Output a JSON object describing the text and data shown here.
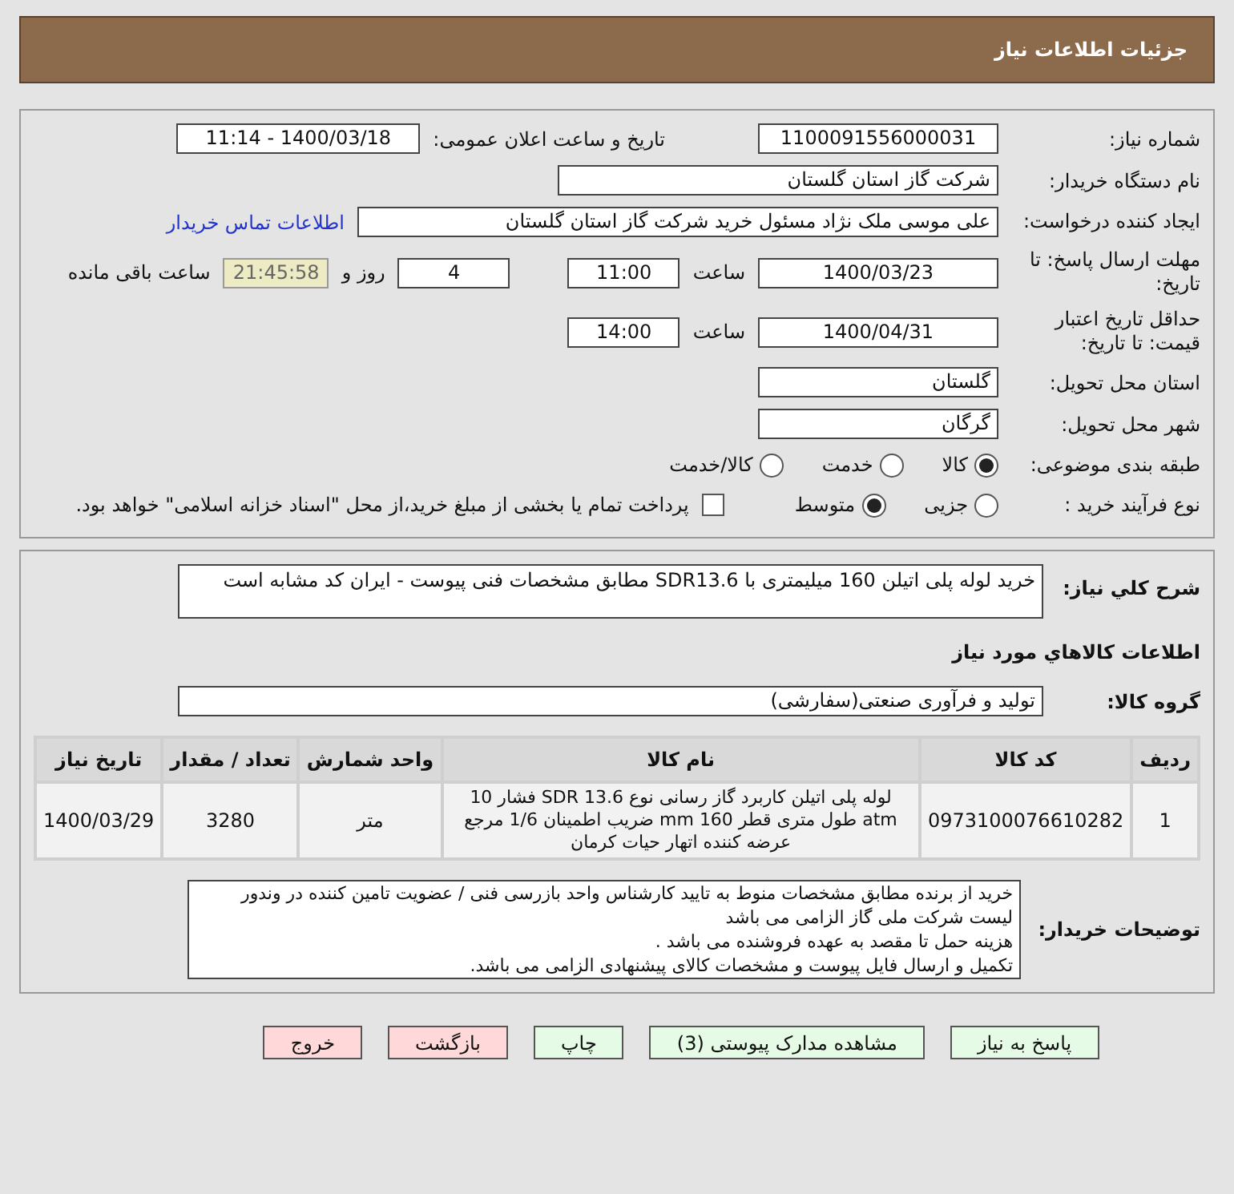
{
  "header": {
    "title": "جزئیات اطلاعات نیاز"
  },
  "details": {
    "need_number": {
      "label": "شماره نیاز:",
      "value": "1100091556000031"
    },
    "announce": {
      "label": "تاریخ و ساعت اعلان عمومی:",
      "value": "1400/03/18 - 11:14"
    },
    "buyer_org": {
      "label": "نام دستگاه خریدار:",
      "value": "شرکت گاز استان گلستان"
    },
    "requester": {
      "label": "ایجاد کننده درخواست:",
      "value": "علی موسی ملک نژاد مسئول خرید شرکت گاز استان گلستان",
      "link": "اطلاعات تماس خریدار"
    },
    "deadline": {
      "label": "مهلت ارسال پاسخ: تا تاریخ:",
      "date": "1400/03/23",
      "time_label": "ساعت",
      "time": "11:00",
      "days": "4",
      "days_label": "روز و",
      "remaining": "21:45:58",
      "remaining_label": "ساعت باقی مانده"
    },
    "validity": {
      "label": "حداقل تاریخ اعتبار قیمت: تا تاریخ:",
      "date": "1400/04/31",
      "time_label": "ساعت",
      "time": "14:00"
    },
    "province": {
      "label": "استان محل تحویل:",
      "value": "گلستان"
    },
    "city": {
      "label": "شهر محل تحویل:",
      "value": "گرگان"
    },
    "category": {
      "label": "طبقه بندی موضوعی:",
      "options": [
        {
          "label": "کالا",
          "selected": true
        },
        {
          "label": "خدمت",
          "selected": false
        },
        {
          "label": "کالا/خدمت",
          "selected": false
        }
      ]
    },
    "purchase_type": {
      "label": "نوع فرآیند خرید :",
      "options": [
        {
          "label": "جزیی",
          "selected": false
        },
        {
          "label": "متوسط",
          "selected": true
        }
      ],
      "payment": {
        "label": "پرداخت تمام یا بخشی از مبلغ خرید،از محل \"اسناد خزانه اسلامی\" خواهد بود.",
        "checked": false
      }
    }
  },
  "summary": {
    "label": "شرح کلي نياز:",
    "value": "خرید لوله پلی اتیلن 160 میلیمتری با SDR13.6  مطابق مشخصات فنی پیوست - ایران کد مشابه است"
  },
  "goods_heading": "اطلاعات کالاهاي مورد نياز",
  "goods_group": {
    "label": "گروه کالا:",
    "value": "تولید و فرآوری صنعتی(سفارشی)"
  },
  "table": {
    "columns": [
      "ردیف",
      "کد کالا",
      "نام کالا",
      "واحد شمارش",
      "تعداد / مقدار",
      "تاریخ نیاز"
    ],
    "rows": [
      [
        "1",
        "0973100076610282",
        "لوله پلی اتیلن کاربرد گاز رسانی نوع SDR 13.6 فشار 10 atm طول متری قطر 160 mm ضریب اطمینان 1/6 مرجع عرضه کننده اتهار حیات کرمان",
        "متر",
        "3280",
        "1400/03/29"
      ]
    ]
  },
  "buyer_notes": {
    "label": "توضیحات خریدار:",
    "lines": [
      "خرید از برنده مطابق مشخصات منوط به تایید کارشناس واحد بازرسی فنی / عضویت تامین کننده در وندور لیست شرکت ملی گاز الزامی می باشد",
      "هزینه حمل تا مقصد به عهده فروشنده می باشد .",
      "تکمیل و ارسال فایل پیوست و مشخصات کالای پیشنهادی الزامی می باشد."
    ]
  },
  "buttons": [
    {
      "label": "پاسخ به نیاز",
      "kind": "normal"
    },
    {
      "label": "مشاهده مدارک پیوستی (3)",
      "kind": "normal"
    },
    {
      "label": "چاپ",
      "kind": "normal"
    },
    {
      "label": "بازگشت",
      "kind": "danger"
    },
    {
      "label": "خروج",
      "kind": "danger"
    }
  ]
}
